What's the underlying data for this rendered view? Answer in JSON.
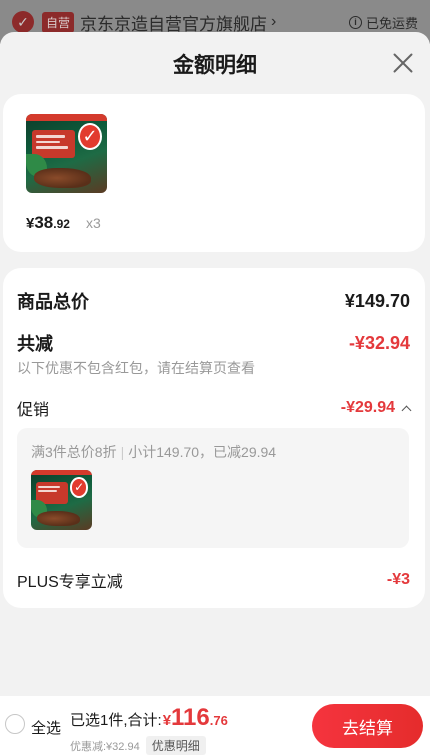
{
  "store": {
    "tag": "自营",
    "name": "京东京造自营官方旗舰店",
    "chevron": "›",
    "free_shipping": "已免运费",
    "info_icon": "i"
  },
  "sheet": {
    "title": "金额明细"
  },
  "product": {
    "price_symbol": "¥",
    "price_int": "38",
    "price_dec": ".92",
    "quantity": "x3",
    "badge_icon": "✓"
  },
  "detail": {
    "total_label": "商品总价",
    "total_value": "¥149.70",
    "reduce_label": "共减",
    "reduce_value": "-¥32.94",
    "reduce_note": "以下优惠不包含红包，请在结算页查看",
    "promo_label": "促销",
    "promo_value": "-¥29.94",
    "promo_rule": "满3件总价8折",
    "promo_summary": "小计149.70，已减29.94",
    "plus_label": "PLUS专享立减",
    "plus_value": "-¥3"
  },
  "bottom": {
    "select_all": "全选",
    "sum_label": "已选1件,合计:",
    "sum_symbol": "¥",
    "sum_int": "116",
    "sum_dec": ".76",
    "discount_text": "优惠减:¥32.94",
    "detail_link": "优惠明细",
    "checkout": "去结算"
  },
  "colors": {
    "accent_red": "#e4393c",
    "muted_text": "#999999"
  }
}
